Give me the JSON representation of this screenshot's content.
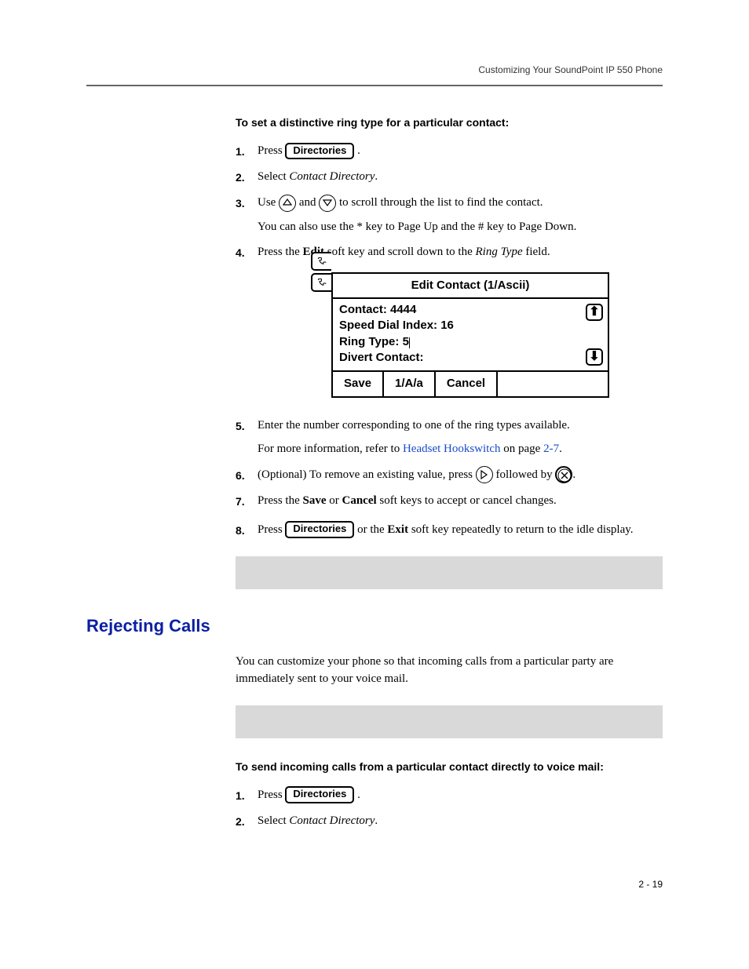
{
  "header": {
    "running_title": "Customizing Your SoundPoint IP 550 Phone"
  },
  "section1": {
    "intro": "To set a distinctive ring type for a particular contact:",
    "steps": {
      "1": {
        "press": "Press ",
        "key": "Directories",
        "period": " ."
      },
      "2": {
        "pre": "Select ",
        "cd": "Contact Directory",
        "post": "."
      },
      "3": {
        "pre": "Use ",
        "and": " and ",
        "post": " to scroll through the list to find the contact.",
        "sub": "You can also use the * key to Page Up and the # key to Page Down."
      },
      "4": {
        "pre": "Press the ",
        "edit": "Edit",
        "mid": " soft key and scroll down to the ",
        "rt": "Ring Type",
        "post": " field."
      },
      "5": {
        "line": "Enter the number corresponding to one of the ring types available.",
        "sub_pre": "For more information, refer to ",
        "sub_link": "Headset Hookswitch",
        "sub_mid": " on page ",
        "sub_page": "2-7",
        "sub_post": "."
      },
      "6": {
        "pre": "(Optional) To remove an existing value, press ",
        "mid": "  followed by ",
        "post": "."
      },
      "7": {
        "pre": "Press the ",
        "save": "Save",
        "or": " or ",
        "cancel": "Cancel",
        "post": " soft keys to accept or cancel changes."
      },
      "8": {
        "press": "Press  ",
        "key": "Directories",
        "mid": "  or the ",
        "exit": "Exit",
        "post": " soft key repeatedly to return to the idle display."
      }
    }
  },
  "lcd": {
    "title": "Edit Contact (1/Ascii)",
    "lines": {
      "contact": "Contact: 4444",
      "sdi": "Speed Dial Index: 16",
      "rt_label": "Ring Type: ",
      "rt_val": "5",
      "divert": "Divert Contact:"
    },
    "softkeys": {
      "save": "Save",
      "mode": "1/A/a",
      "cancel": "Cancel"
    }
  },
  "section2": {
    "heading": "Rejecting Calls",
    "para": "You can customize your phone so that incoming calls from a particular party are immediately sent to your voice mail.",
    "intro": "To send incoming calls from a particular contact directly to voice mail:",
    "steps": {
      "1": {
        "press": "Press ",
        "key": "Directories",
        "period": " ."
      },
      "2": {
        "pre": "Select ",
        "cd": "Contact Directory",
        "post": "."
      }
    }
  },
  "footer": {
    "page": "2 - 19"
  }
}
